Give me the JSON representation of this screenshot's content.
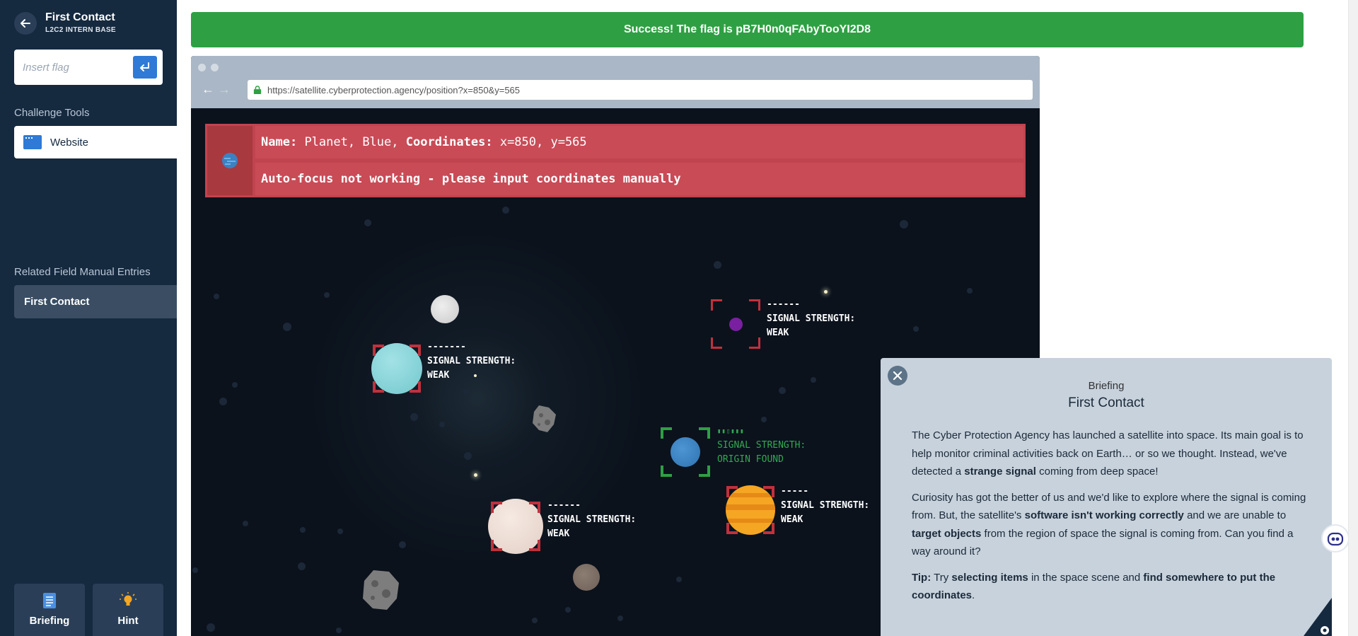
{
  "sidebar": {
    "title": "First Contact",
    "subtitle": "L2C2 INTERN BASE",
    "flag_placeholder": "Insert flag",
    "challenge_tools_label": "Challenge Tools",
    "tools": [
      {
        "label": "Website",
        "icon": "browser-window-icon"
      }
    ],
    "manual_label": "Related Field Manual Entries",
    "manual_items": [
      {
        "label": "First Contact"
      }
    ],
    "buttons": {
      "briefing": "Briefing",
      "hint": "Hint"
    }
  },
  "banner": {
    "text": "Success! The flag is pB7H0n0qFAbyTooYI2D8",
    "color": "#2ea043"
  },
  "browser": {
    "url": "https://satellite.cyberprotection.agency/position?x=850&y=565",
    "info": {
      "name_label": "Name:",
      "name_value": "Planet, Blue,",
      "coords_label": "Coordinates:",
      "coords_value": "x=850, y=565",
      "message": "Auto-focus not working - please input coordinates manually"
    },
    "targets": [
      {
        "dashes": "-------",
        "l1": "SIGNAL STRENGTH:",
        "l2": "WEAK"
      },
      {
        "dashes": "------",
        "l1": "SIGNAL STRENGTH:",
        "l2": "WEAK"
      },
      {
        "dashes": "▮▮▯▮▮▮",
        "l1": "SIGNAL STRENGTH:",
        "l2": "ORIGIN FOUND"
      },
      {
        "dashes": "------",
        "l1": "SIGNAL STRENGTH:",
        "l2": "WEAK"
      },
      {
        "dashes": "-----",
        "l1": "SIGNAL STRENGTH:",
        "l2": "WEAK"
      }
    ]
  },
  "briefing": {
    "kicker": "Briefing",
    "title": "First Contact",
    "p1": [
      "The Cyber Protection Agency has launched a satellite into space. Its main goal is to help monitor criminal activities back on Earth… or so we thought. Instead, we've detected a ",
      "strange signal",
      " coming from deep space!"
    ],
    "p2": [
      "Curiosity has got the better of us and we'd like to explore where the signal is coming from. But, the satellite's ",
      "software isn't working correctly",
      " and we are unable to ",
      "target objects",
      " from the region of space the signal is coming from. Can you find a way around it?"
    ],
    "p3": [
      "Tip:",
      " Try ",
      "selecting items",
      " in the space scene and ",
      "find somewhere to put the coordinates",
      "."
    ]
  }
}
